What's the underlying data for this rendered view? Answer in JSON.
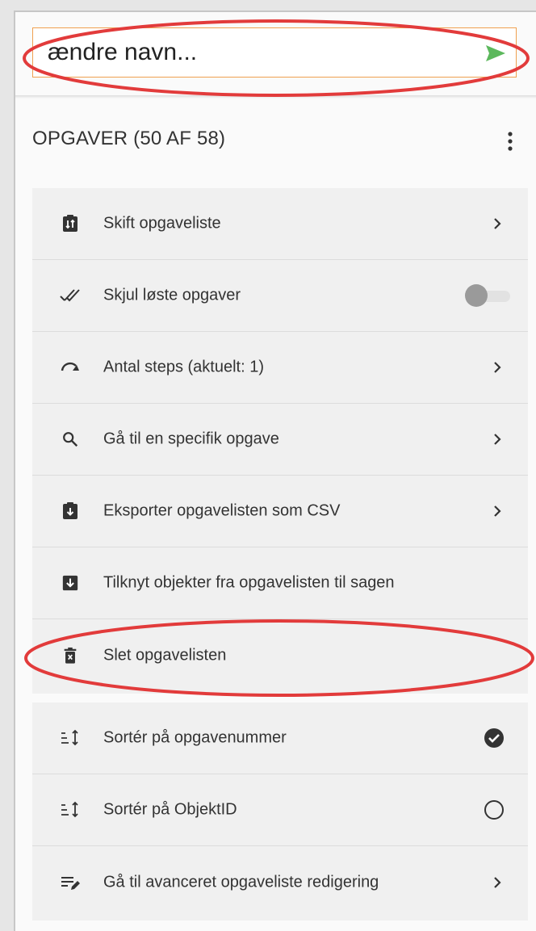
{
  "search": {
    "value": "ændre navn..."
  },
  "header": {
    "title": "OPGAVER (50 AF 58)"
  },
  "menu_group_1": [
    {
      "label": "Skift opgaveliste",
      "icon": "swap-list-icon",
      "control": "chevron"
    },
    {
      "label": "Skjul løste opgaver",
      "icon": "double-check-icon",
      "control": "toggle",
      "toggle_on": false
    },
    {
      "label": "Antal steps (aktuelt: 1)",
      "icon": "step-arrow-icon",
      "control": "chevron"
    },
    {
      "label": "Gå til en specifik opgave",
      "icon": "search-icon",
      "control": "chevron"
    },
    {
      "label": "Eksporter opgavelisten som CSV",
      "icon": "export-clipboard-icon",
      "control": "chevron"
    },
    {
      "label": "Tilknyt objekter fra opgavelisten til sagen",
      "icon": "download-box-icon",
      "control": "none"
    },
    {
      "label": "Slet opgavelisten",
      "icon": "trash-icon",
      "control": "none"
    }
  ],
  "menu_group_2": [
    {
      "label": "Sortér på opgavenummer",
      "icon": "sort-icon",
      "control": "radio",
      "selected": true
    },
    {
      "label": "Sortér på ObjektID",
      "icon": "sort-icon",
      "control": "radio",
      "selected": false
    },
    {
      "label": "Gå til avanceret opgaveliste redigering",
      "icon": "edit-list-icon",
      "control": "chevron"
    }
  ],
  "colors": {
    "accent_send": "#5cb85c",
    "annotation": "#e23b3b",
    "input_border": "#f0a050"
  }
}
